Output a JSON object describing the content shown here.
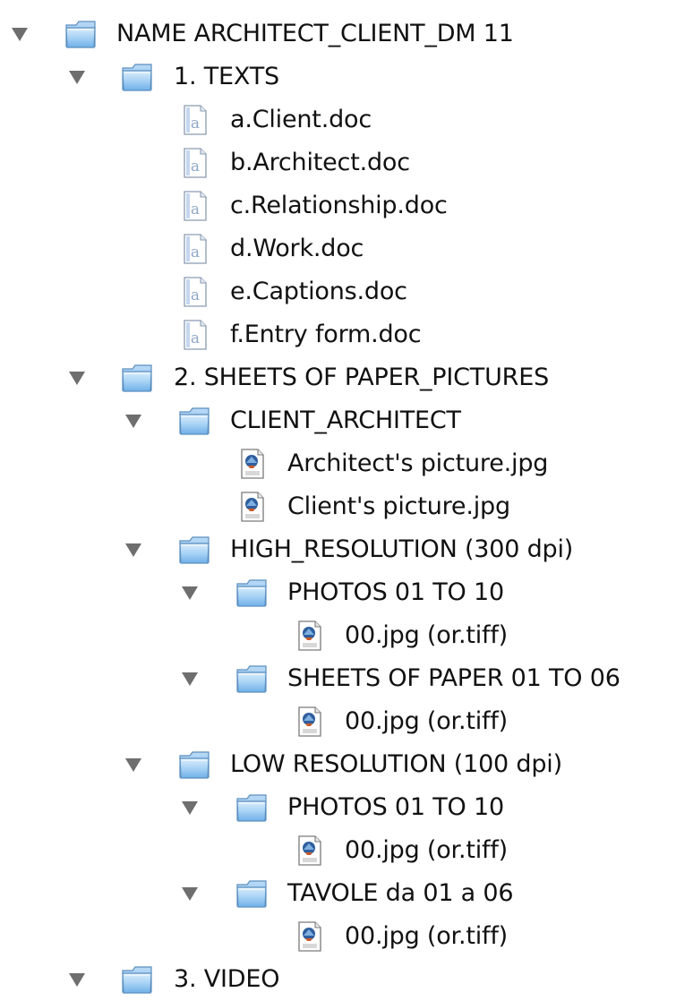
{
  "tree": {
    "root": {
      "label": "NAME ARCHITECT_CLIENT_DM 11"
    },
    "texts": {
      "label": "1. TEXTS",
      "files": [
        "a.Client.doc",
        "b.Architect.doc",
        "c.Relationship.doc",
        "d.Work.doc",
        "e.Captions.doc",
        "f.Entry form.doc"
      ]
    },
    "sheets": {
      "label": "2. SHEETS OF PAPER_PICTURES",
      "client_architect": {
        "label": "CLIENT_ARCHITECT",
        "files": [
          "Architect's picture.jpg",
          "Client's picture.jpg"
        ]
      },
      "high_res": {
        "label": "HIGH_RESOLUTION (300 dpi)",
        "photos": {
          "label": "PHOTOS 01 TO 10",
          "file": "00.jpg (or.tiff)"
        },
        "sheets": {
          "label": "SHEETS OF PAPER 01 TO 06",
          "file": "00.jpg (or.tiff)"
        }
      },
      "low_res": {
        "label": "LOW RESOLUTION (100 dpi)",
        "photos": {
          "label": "PHOTOS 01 TO 10",
          "file": "00.jpg (or.tiff)"
        },
        "tavole": {
          "label": "TAVOLE da 01 a 06",
          "file": "00.jpg (or.tiff)"
        }
      }
    },
    "video": {
      "label": "3. VIDEO"
    }
  },
  "icons": {
    "folder": "folder-icon",
    "document": "word-document-icon",
    "image": "image-file-icon"
  },
  "colors": {
    "disclosure_triangle": "#6e6e6e",
    "folder_blue": "#8fc3ef",
    "text": "#111111"
  }
}
